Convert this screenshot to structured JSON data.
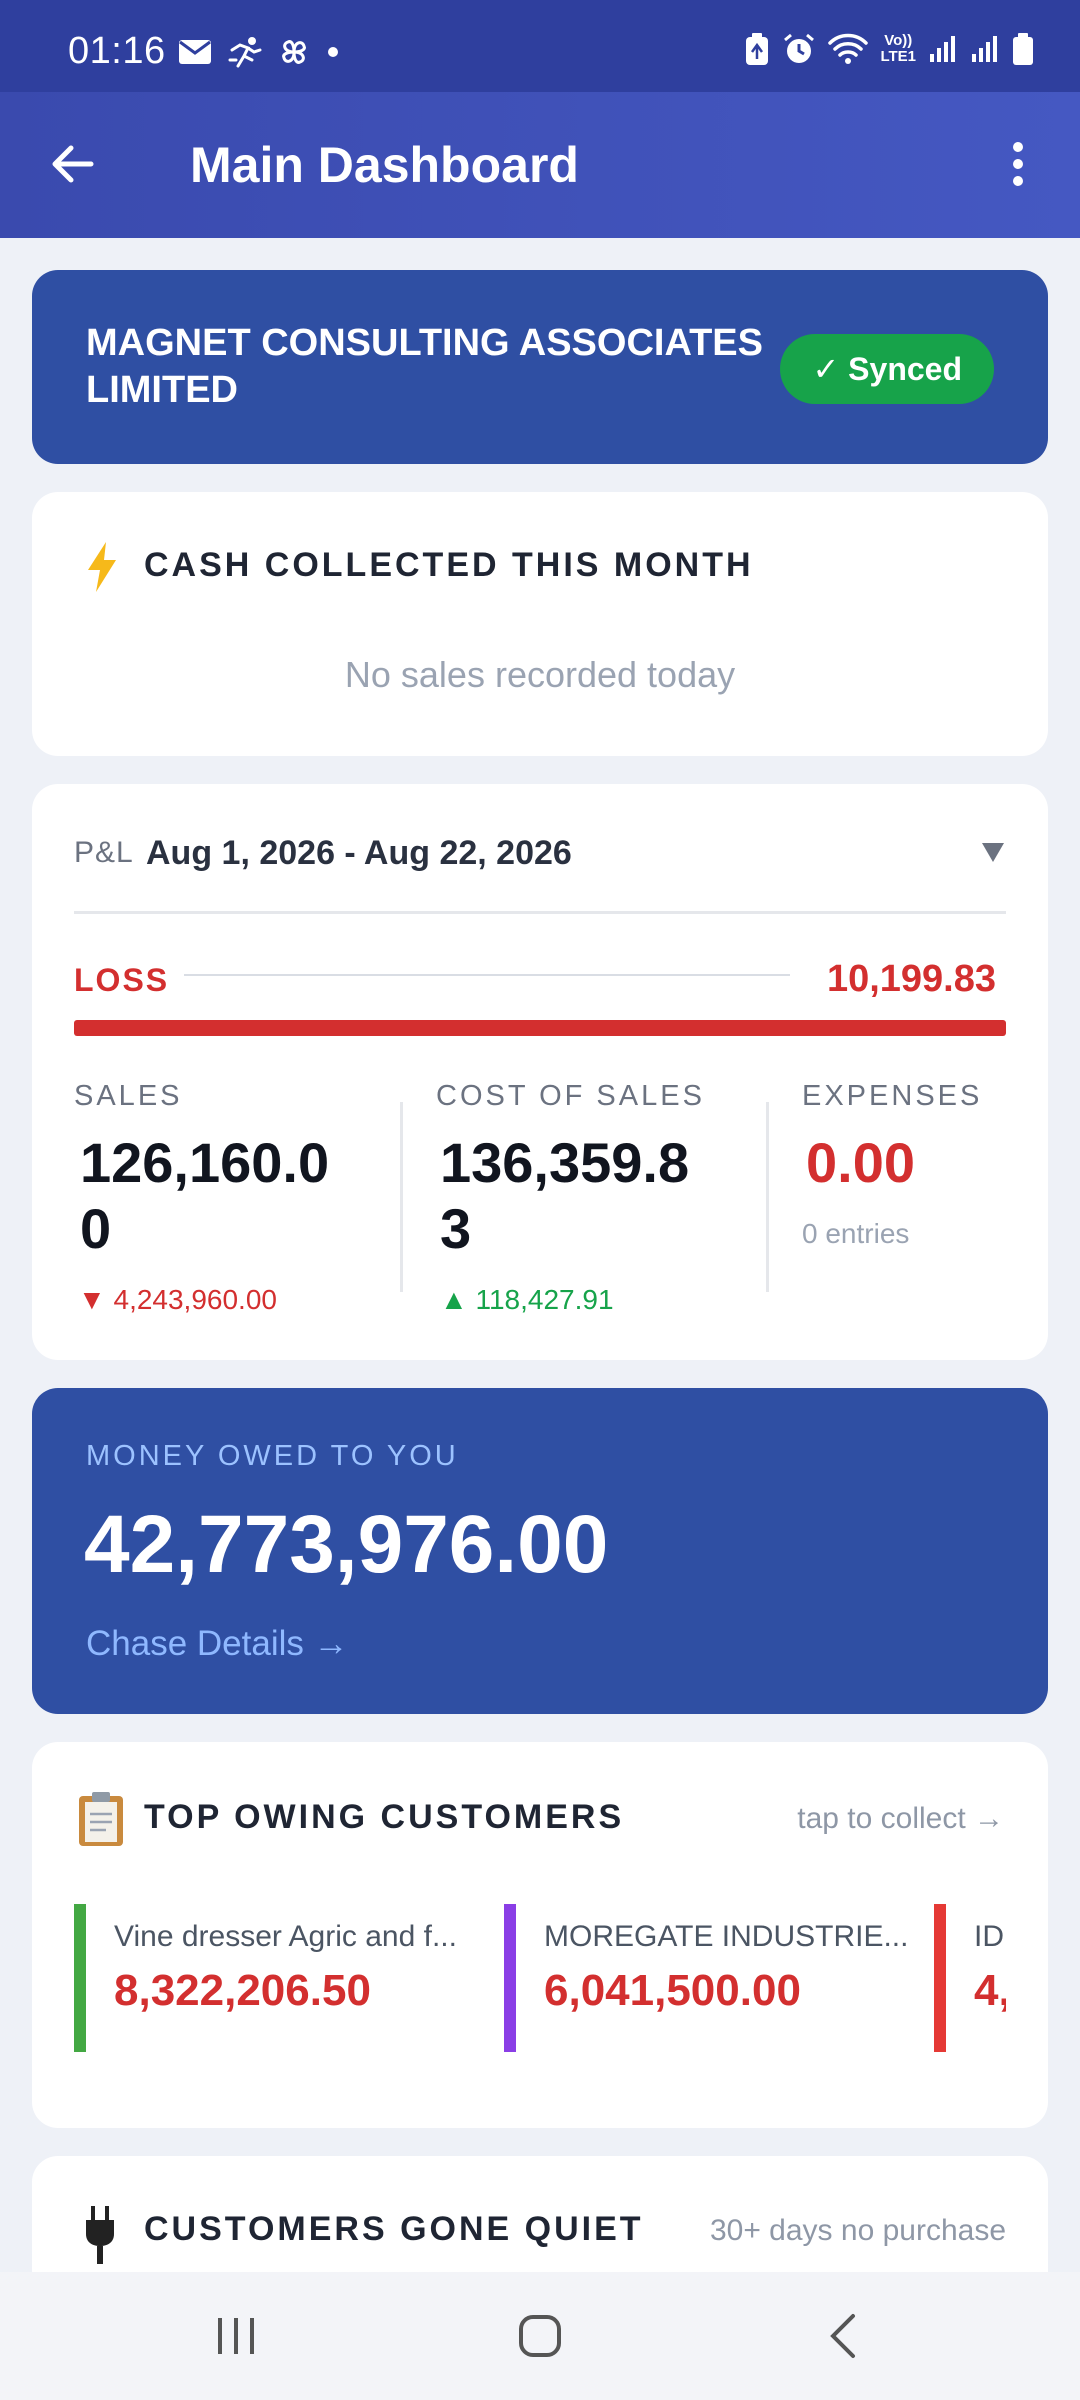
{
  "status_bar": {
    "time": "01:16",
    "left_icons": [
      "mail-icon",
      "running-icon",
      "pinwheel-icon",
      "dot-icon"
    ],
    "right_icons": [
      "battery-saver-icon",
      "alarm-icon",
      "wifi-icon",
      "volte-icon",
      "signal-icon",
      "signal-icon",
      "battery-icon"
    ],
    "volte_label": "Vo))",
    "lte_label": "LTE1"
  },
  "app_bar": {
    "title": "Main Dashboard"
  },
  "company": {
    "name": "MAGNET CONSULTING ASSOCIATES LIMITED",
    "sync_status": "✓ Synced"
  },
  "cash_collected": {
    "title": "CASH COLLECTED THIS MONTH",
    "empty_message": "No sales recorded today"
  },
  "pnl": {
    "prefix": "P&L",
    "date_range": "Aug 1, 2026 - Aug 22, 2026",
    "result_label": "LOSS",
    "result_value": "10,199.83",
    "metrics": [
      {
        "label": "SALES",
        "value": "126,160.00",
        "sub": "▼ 4,243,960.00",
        "sub_color": "#d32f2f"
      },
      {
        "label": "COST OF SALES",
        "value": "136,359.83",
        "sub": "▲ 118,427.91",
        "sub_color": "#16a34a"
      },
      {
        "label": "EXPENSES",
        "value": "0.00",
        "sub": "0 entries",
        "sub_color": "#9aa3b2"
      }
    ]
  },
  "money_owed": {
    "label": "MONEY OWED TO YOU",
    "value": "42,773,976.00",
    "link": "Chase Details →"
  },
  "top_owing": {
    "title": "TOP OWING CUSTOMERS",
    "hint": "tap to collect →",
    "customers": [
      {
        "name": "Vine dresser Agric and f...",
        "amount": "8,322,206.50",
        "color": "#43a843"
      },
      {
        "name": "MOREGATE INDUSTRIE...",
        "amount": "6,041,500.00",
        "color": "#8a3ee6"
      },
      {
        "name": "IDI",
        "amount": "4,",
        "color": "#e53935"
      }
    ]
  },
  "gone_quiet": {
    "title": "CUSTOMERS GONE QUIET",
    "hint": "30+ days no purchase"
  },
  "colors": {
    "primary": "#2f4fa3",
    "appbar": "#3a4aae",
    "loss": "#d32f2f",
    "positive": "#16a34a"
  }
}
